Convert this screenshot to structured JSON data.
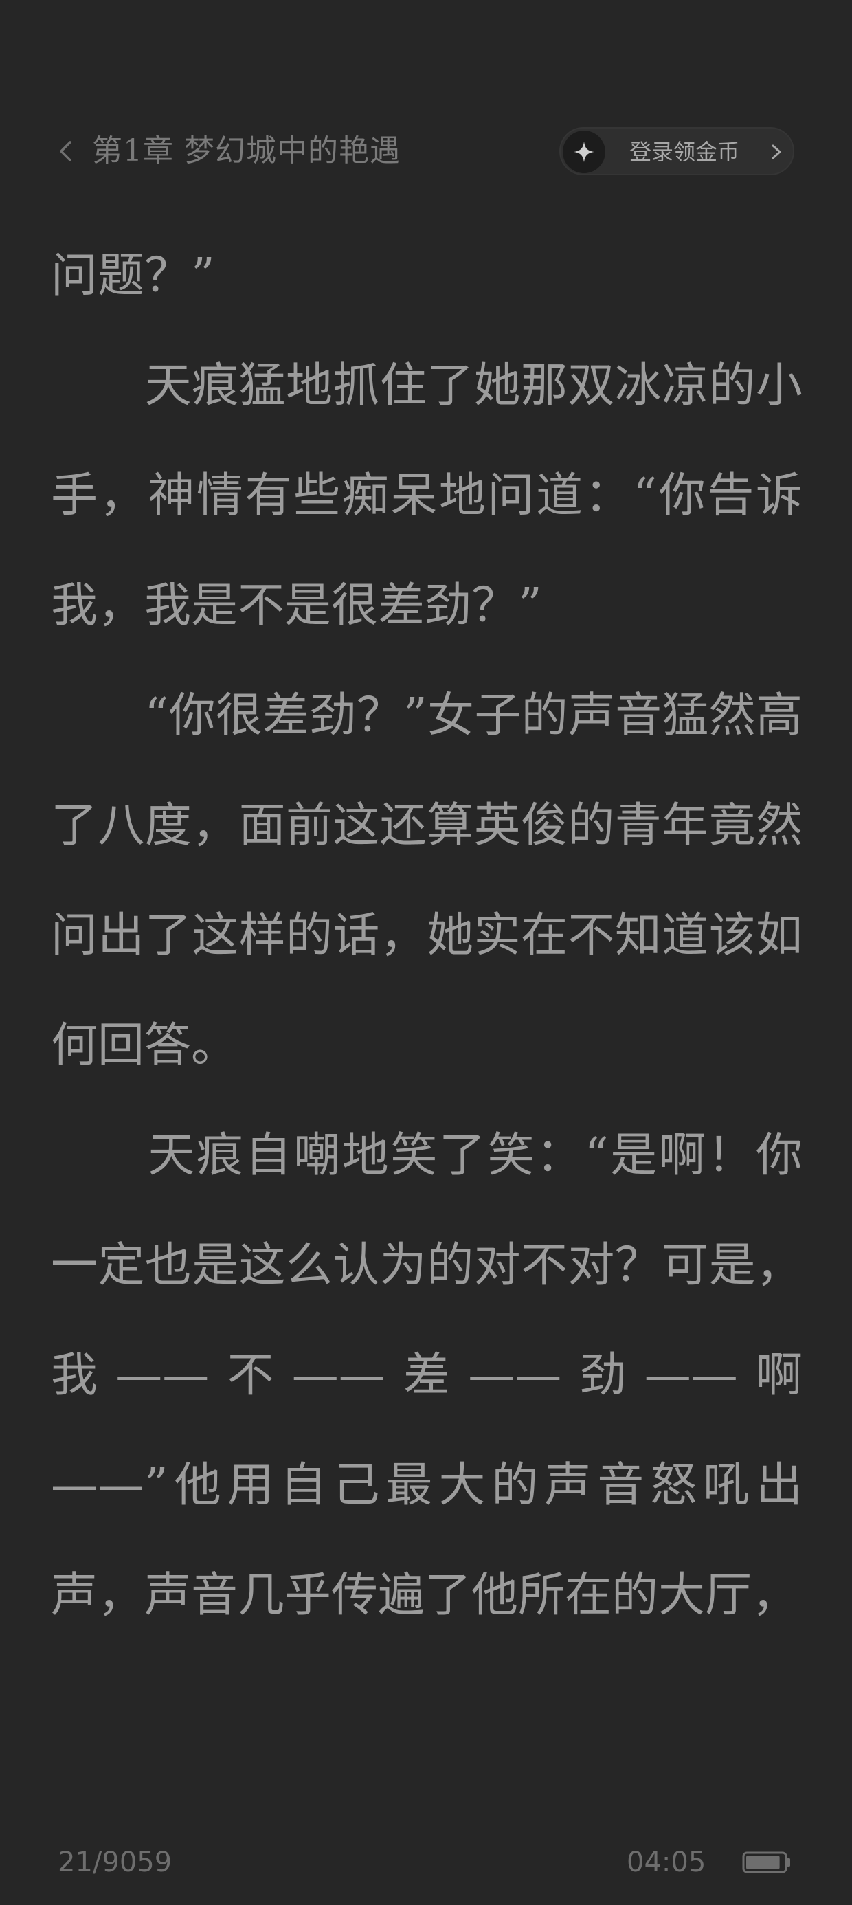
{
  "header": {
    "chapter_title": "第1章 梦幻城中的艳遇",
    "coin_label": "登录领金币",
    "icons": {
      "back": "chevron-left-icon",
      "coin_avatar": "sparkle-icon",
      "coin_arrow": "chevron-right-icon"
    }
  },
  "content": {
    "paragraphs": [
      "问题？”",
      "　　天痕猛地抓住了她那双冰凉的小手，神情有些痴呆地问道：“你告诉我，我是不是很差劲？”",
      "　　“你很差劲？”女子的声音猛然高了八度，面前这还算英俊的青年竟然问出了这样的话，她实在不知道该如何回答。",
      "　　天痕自嘲地笑了笑：“是啊！你一定也是这么认为的对不对？可是，我——不——差——劲——啊——”他用自己最大的声音怒吼出声，声音几乎传遍了他所在的大厅，"
    ]
  },
  "footer": {
    "progress": "21/9059",
    "time": "04:05",
    "battery_icon": "battery-icon",
    "battery_level": 0.9
  },
  "colors": {
    "background": "#262626",
    "text": "#9c9c9c",
    "muted": "#7a7a7a"
  }
}
